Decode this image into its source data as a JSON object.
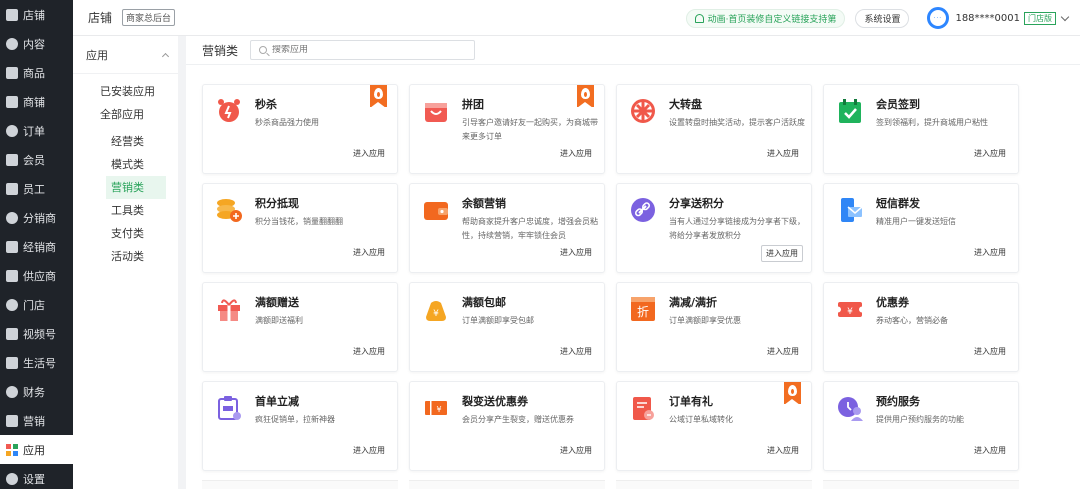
{
  "nav": {
    "items": [
      {
        "label": "店铺",
        "icon": "home-icon"
      },
      {
        "label": "内容",
        "icon": "layers-icon"
      },
      {
        "label": "商品",
        "icon": "goods-icon"
      },
      {
        "label": "商铺",
        "icon": "heart-icon"
      },
      {
        "label": "订单",
        "icon": "order-icon"
      },
      {
        "label": "会员",
        "icon": "member-icon"
      },
      {
        "label": "员工",
        "icon": "staff-icon"
      },
      {
        "label": "分销商",
        "icon": "distributor-icon"
      },
      {
        "label": "经销商",
        "icon": "dealer-icon"
      },
      {
        "label": "供应商",
        "icon": "supplier-icon"
      },
      {
        "label": "门店",
        "icon": "store-icon"
      },
      {
        "label": "视频号",
        "icon": "video-icon"
      },
      {
        "label": "生活号",
        "icon": "life-icon"
      },
      {
        "label": "财务",
        "icon": "finance-icon"
      },
      {
        "label": "营销",
        "icon": "marketing-icon"
      },
      {
        "label": "应用",
        "icon": "apps-icon"
      },
      {
        "label": "设置",
        "icon": "gear-icon"
      }
    ],
    "active_index": 15
  },
  "header": {
    "title": "店铺",
    "tag": "商家总后台",
    "notice": "动画·首页装修自定义链接支持第",
    "system_settings": "系统设置",
    "phone": "188****0001",
    "store_tag": "门店版"
  },
  "side2": {
    "title": "应用",
    "items": [
      "已安装应用",
      "全部应用"
    ],
    "subitems": [
      "经营类",
      "模式类",
      "营销类",
      "工具类",
      "支付类",
      "活动类"
    ],
    "active_sub": 2
  },
  "main": {
    "category": "营销类",
    "search_placeholder": "搜索应用",
    "enter_label": "进入应用",
    "cards": [
      {
        "title": "秒杀",
        "desc": "秒杀商品强力使用",
        "icon": "alarm-clock-icon",
        "color": "#f0584a",
        "hot": true
      },
      {
        "title": "拼团",
        "desc": "引导客户邀请好友一起购买，为商城带来更多订单",
        "icon": "shopping-bag-icon",
        "color": "#f15a52",
        "hot": true
      },
      {
        "title": "大转盘",
        "desc": "设置转盘时抽奖活动，提示客户活跃度",
        "icon": "wheel-icon",
        "color": "#f0584a",
        "hot": false
      },
      {
        "title": "会员签到",
        "desc": "签到领福利，提升商城用户粘性",
        "icon": "calendar-check-icon",
        "color": "#1fb35c",
        "hot": false
      },
      {
        "title": "积分抵现",
        "desc": "积分当钱花，销量翻翻翻",
        "icon": "coins-icon",
        "color": "#f5a623",
        "hot": false
      },
      {
        "title": "余额营销",
        "desc": "帮助商家提升客户忠诚度，增强会员粘性，持续营销，牢牢锁住会员",
        "icon": "wallet-icon",
        "color": "#f2681f",
        "hot": false
      },
      {
        "title": "分享送积分",
        "desc": "当有人通过分享链接成为分享者下级，将给分享者发放积分",
        "icon": "link-icon",
        "color": "#7b61e0",
        "hot": false
      },
      {
        "title": "短信群发",
        "desc": "精准用户一键发送短信",
        "icon": "sms-icon",
        "color": "#2f86f6",
        "hot": false
      },
      {
        "title": "满额赠送",
        "desc": "满额即送福利",
        "icon": "gift-icon",
        "color": "#f15a52",
        "hot": false
      },
      {
        "title": "满额包邮",
        "desc": "订单满额即享受包邮",
        "icon": "money-bag-icon",
        "color": "#f5a623",
        "hot": false
      },
      {
        "title": "满减/满折",
        "desc": "订单满额即享受优惠",
        "icon": "discount-icon",
        "color": "#f2681f",
        "hot": false
      },
      {
        "title": "优惠券",
        "desc": "券动客心，营销必备",
        "icon": "coupon-icon",
        "color": "#f0584a",
        "hot": false
      },
      {
        "title": "首单立减",
        "desc": "疯狂促销单，拉新神器",
        "icon": "first-order-icon",
        "color": "#7b61e0",
        "hot": false
      },
      {
        "title": "裂变送优惠券",
        "desc": "会员分享产生裂变，赠送优惠券",
        "icon": "fission-coupon-icon",
        "color": "#f2681f",
        "hot": false
      },
      {
        "title": "订单有礼",
        "desc": "公域订单私域转化",
        "icon": "order-gift-icon",
        "color": "#f0584a",
        "hot": true
      },
      {
        "title": "预约服务",
        "desc": "提供用户预约服务的功能",
        "icon": "appointment-icon",
        "color": "#7b61e0",
        "hot": false
      }
    ]
  },
  "colors": {
    "accent": "#29a35a",
    "nav_bg": "#1f2329",
    "hot_flag": "#f26d21"
  }
}
